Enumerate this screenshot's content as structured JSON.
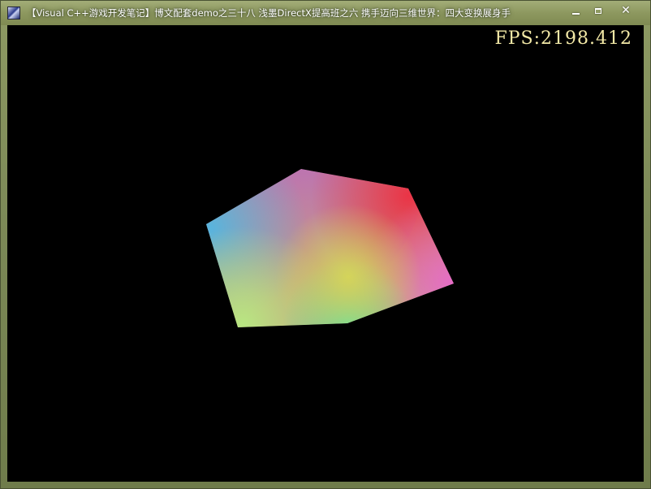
{
  "window": {
    "title": "【Visual C++游戏开发笔记】博文配套demo之三十八 浅墨DirectX提高班之六 携手迈向三维世界：四大变换展身手",
    "controls": {
      "minimize_icon": "minimize-icon",
      "maximize_icon": "maximize-icon",
      "close_icon": "close-icon",
      "close_glyph": "✕"
    }
  },
  "viewport": {
    "fps_text": "FPS:2198.412",
    "fps_color": "#f2e8a6",
    "background_color": "#000000"
  },
  "scene": {
    "object": "rotating-color-cube",
    "vertex_colors": {
      "top": "#b860c8",
      "top_right": "#e83a4c",
      "right": "#e66cc6",
      "bottom_right": "#78ded0",
      "bottom_mid": "#62e098",
      "bottom_left": "#b6e486",
      "left": "#5eb6dc",
      "center": "#cfd35e"
    }
  }
}
